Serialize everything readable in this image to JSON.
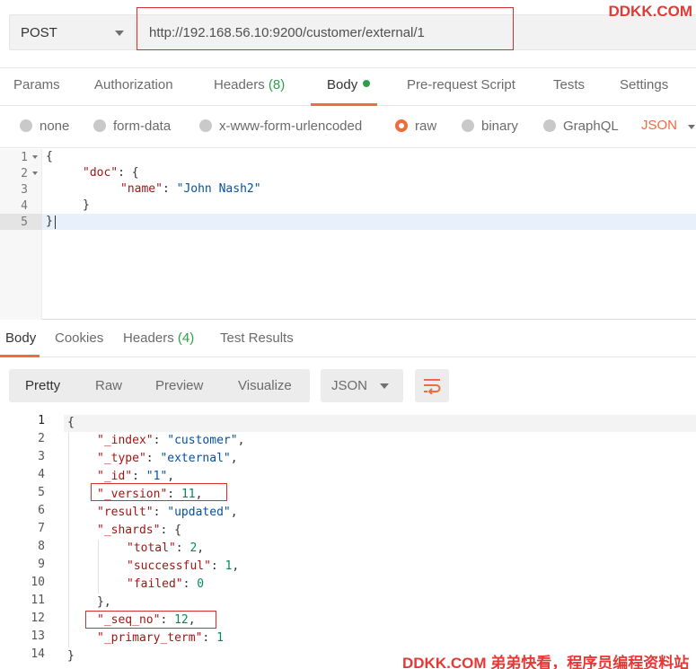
{
  "watermark_top": "DDKK.COM",
  "watermark_bottom": "DDKK.COM 弟弟快看，程序员编程资料站",
  "request": {
    "method": "POST",
    "url": "http://192.168.56.10:9200/customer/external/1"
  },
  "request_tabs": [
    {
      "label": "Params"
    },
    {
      "label": "Authorization"
    },
    {
      "label": "Headers",
      "count": "(8)"
    },
    {
      "label": "Body",
      "active": true
    },
    {
      "label": "Pre-request Script"
    },
    {
      "label": "Tests"
    },
    {
      "label": "Settings"
    }
  ],
  "body_types": [
    "none",
    "form-data",
    "x-www-form-urlencoded",
    "raw",
    "binary",
    "GraphQL"
  ],
  "body_type_selected": "raw",
  "body_language": "JSON",
  "request_body_lines": [
    {
      "n": "1",
      "text": "{"
    },
    {
      "n": "2",
      "key": "\"doc\"",
      "rest": ": {"
    },
    {
      "n": "3",
      "key": "\"name\"",
      "rest": ": ",
      "value": "\"John Nash2\""
    },
    {
      "n": "4",
      "text": "}"
    },
    {
      "n": "5",
      "text": "}"
    }
  ],
  "response_tabs": [
    {
      "label": "Body",
      "active": true
    },
    {
      "label": "Cookies"
    },
    {
      "label": "Headers",
      "count": "(4)"
    },
    {
      "label": "Test Results"
    }
  ],
  "view_modes": [
    "Pretty",
    "Raw",
    "Preview",
    "Visualize"
  ],
  "response_language": "JSON",
  "response_lines": [
    {
      "n": "1",
      "parts": [
        [
          "p",
          "{"
        ]
      ]
    },
    {
      "n": "2",
      "parts": [
        [
          "k",
          "\"_index\""
        ],
        [
          "p",
          ": "
        ],
        [
          "s",
          "\"customer\""
        ],
        [
          "p",
          ","
        ]
      ]
    },
    {
      "n": "3",
      "parts": [
        [
          "k",
          "\"_type\""
        ],
        [
          "p",
          ": "
        ],
        [
          "s",
          "\"external\""
        ],
        [
          "p",
          ","
        ]
      ]
    },
    {
      "n": "4",
      "parts": [
        [
          "k",
          "\"_id\""
        ],
        [
          "p",
          ": "
        ],
        [
          "s",
          "\"1\""
        ],
        [
          "p",
          ","
        ]
      ]
    },
    {
      "n": "5",
      "parts": [
        [
          "k",
          "\"_version\""
        ],
        [
          "p",
          ": "
        ],
        [
          "n",
          "11"
        ],
        [
          "p",
          ","
        ]
      ]
    },
    {
      "n": "6",
      "parts": [
        [
          "k",
          "\"result\""
        ],
        [
          "p",
          ": "
        ],
        [
          "s",
          "\"updated\""
        ],
        [
          "p",
          ","
        ]
      ]
    },
    {
      "n": "7",
      "parts": [
        [
          "k",
          "\"_shards\""
        ],
        [
          "p",
          ": {"
        ]
      ]
    },
    {
      "n": "8",
      "parts": [
        [
          "k",
          "\"total\""
        ],
        [
          "p",
          ": "
        ],
        [
          "n",
          "2"
        ],
        [
          "p",
          ","
        ]
      ]
    },
    {
      "n": "9",
      "parts": [
        [
          "k",
          "\"successful\""
        ],
        [
          "p",
          ": "
        ],
        [
          "n",
          "1"
        ],
        [
          "p",
          ","
        ]
      ]
    },
    {
      "n": "10",
      "parts": [
        [
          "k",
          "\"failed\""
        ],
        [
          "p",
          ": "
        ],
        [
          "n",
          "0"
        ]
      ]
    },
    {
      "n": "11",
      "parts": [
        [
          "p",
          "},"
        ]
      ]
    },
    {
      "n": "12",
      "parts": [
        [
          "k",
          "\"_seq_no\""
        ],
        [
          "p",
          ": "
        ],
        [
          "n",
          "12"
        ],
        [
          "p",
          ","
        ]
      ]
    },
    {
      "n": "13",
      "parts": [
        [
          "k",
          "\"_primary_term\""
        ],
        [
          "p",
          ": "
        ],
        [
          "n",
          "1"
        ]
      ]
    },
    {
      "n": "14",
      "parts": [
        [
          "p",
          "}"
        ]
      ]
    }
  ],
  "colors": {
    "accent": "#f26b3a",
    "green": "#2e9e48",
    "highlight_box": "#d32f2f"
  }
}
